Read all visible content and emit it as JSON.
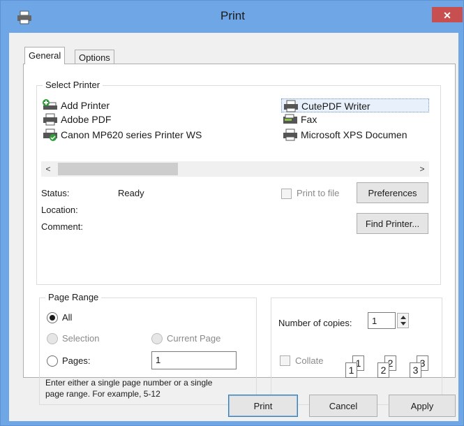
{
  "window": {
    "title": "Print",
    "close_label": "✕"
  },
  "tabs": [
    {
      "label": "General"
    },
    {
      "label": "Options"
    }
  ],
  "select_printer": {
    "legend": "Select Printer",
    "printers": [
      {
        "label": "Add Printer",
        "icon": "add-printer-icon"
      },
      {
        "label": "Adobe PDF",
        "icon": "printer-icon"
      },
      {
        "label": "Canon MP620 series Printer WS",
        "icon": "network-printer-icon"
      },
      {
        "label": "CutePDF Writer",
        "icon": "printer-icon",
        "selected": true
      },
      {
        "label": "Fax",
        "icon": "fax-icon"
      },
      {
        "label": "Microsoft XPS Documen",
        "icon": "printer-icon"
      }
    ],
    "scroll_left": "<",
    "scroll_right": ">",
    "status_label": "Status:",
    "status_value": "Ready",
    "location_label": "Location:",
    "comment_label": "Comment:",
    "print_to_file": "Print to file",
    "preferences_button": "Preferences",
    "find_printer_button": "Find Printer..."
  },
  "page_range": {
    "legend": "Page Range",
    "all": "All",
    "selection": "Selection",
    "current_page": "Current Page",
    "pages": "Pages:",
    "pages_value": "1",
    "hint_line1": "Enter either a single page number or a single",
    "hint_line2": "page range.  For example, 5-12"
  },
  "copies": {
    "label": "Number of copies:",
    "value": "1",
    "collate": "Collate",
    "collate_pages": [
      "1",
      "1",
      "2",
      "2",
      "3",
      "3"
    ]
  },
  "footer": {
    "print": "Print",
    "cancel": "Cancel",
    "apply": "Apply"
  },
  "colors": {
    "frame": "#6ea6e6",
    "close": "#c74f4f",
    "dialog": "#f0f0f0"
  }
}
